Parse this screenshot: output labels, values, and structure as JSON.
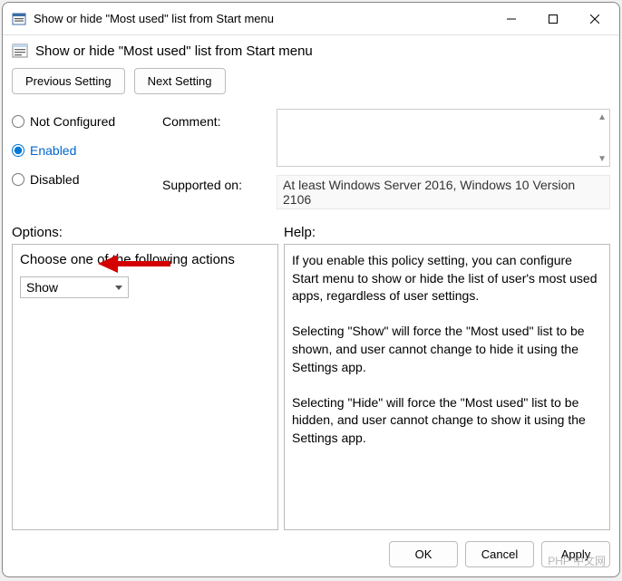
{
  "window": {
    "title": "Show or hide \"Most used\" list from Start menu"
  },
  "header": {
    "title": "Show or hide \"Most used\" list from Start menu"
  },
  "nav": {
    "previous": "Previous Setting",
    "next": "Next Setting"
  },
  "config": {
    "not_configured_label": "Not Configured",
    "enabled_label": "Enabled",
    "disabled_label": "Disabled",
    "selected": "enabled",
    "comment_label": "Comment:",
    "comment_value": "",
    "supported_label": "Supported on:",
    "supported_value": "At least Windows Server 2016, Windows 10 Version 2106"
  },
  "labels": {
    "options": "Options:",
    "help": "Help:"
  },
  "options": {
    "prompt": "Choose one of the following actions",
    "selected_value": "Show"
  },
  "help": {
    "text": "If you enable this policy setting, you can configure Start menu to show or hide the list of user's most used apps, regardless of user settings.\n\nSelecting \"Show\" will force the \"Most used\" list to be shown, and user cannot change to hide it using the Settings app.\n\nSelecting \"Hide\" will force the \"Most used\" list to be hidden, and user cannot change to show it using the Settings app."
  },
  "footer": {
    "ok": "OK",
    "cancel": "Cancel",
    "apply": "Apply"
  },
  "watermark": "PHP 中文网"
}
